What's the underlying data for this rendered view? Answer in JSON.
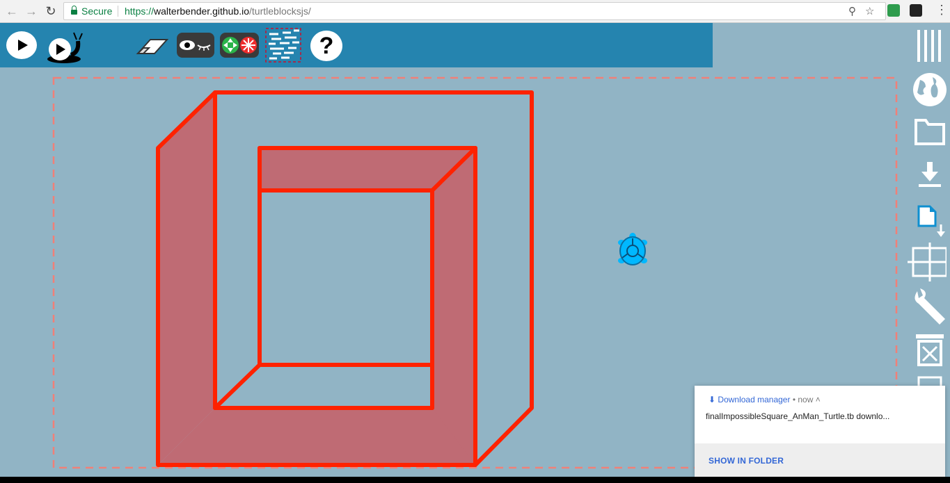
{
  "browser": {
    "secure_label": "Secure",
    "url_scheme": "https://",
    "url_host": "walterbender.github.io",
    "url_path": "/turtleblocksjs/"
  },
  "toolbar": {
    "icons": [
      "play-icon",
      "slow-play-snail-icon",
      "eraser-icon",
      "hide-show-blocks-icon",
      "expand-collapse-icon",
      "palette-icon",
      "help-icon"
    ],
    "help_label": "?"
  },
  "right_palette": {
    "icons": [
      "menu-icon",
      "globe-icon",
      "folder-icon",
      "download-icon",
      "new-file-icon",
      "grid-icon",
      "wrench-icon",
      "trash-icon",
      "print-icon"
    ]
  },
  "download": {
    "title": "Download manager",
    "time": "now",
    "filename": "finalImpossibleSquare_AnMan_Turtle.tb downlo...",
    "show_in_folder": "SHOW IN FOLDER"
  },
  "colors": {
    "canvas_bg": "#91b4c5",
    "toolbar_bg": "#2584af",
    "stroke_red": "#ff2200",
    "fill_rose": "#bf6b74",
    "turtle": "#00b8ff"
  }
}
